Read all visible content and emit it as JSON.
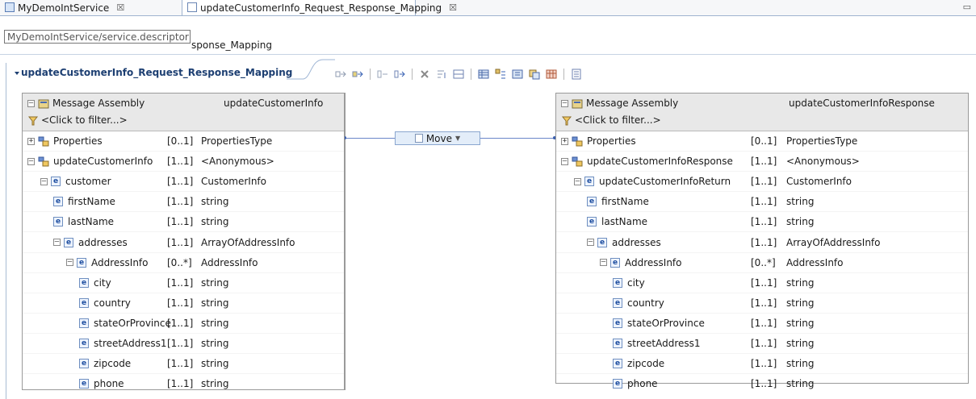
{
  "tabs": [
    {
      "label": "MyDemoIntService",
      "close": "☒"
    },
    {
      "label": "updateCustomerInfo_Request_Response_Mapping",
      "close": "☒"
    }
  ],
  "tooltip": "MyDemoIntService/service.descriptor",
  "subheader_visible_text": "sponse_Mapping",
  "editor_title": "updateCustomerInfo_Request_Response_Mapping",
  "move_label": "Move",
  "left": {
    "title": "Message Assembly",
    "type": "updateCustomerInfo",
    "filter": "<Click to filter...>",
    "rows": [
      {
        "name": "Properties",
        "card": "[0..1]",
        "type": "PropertiesType"
      },
      {
        "name": "updateCustomerInfo",
        "card": "[1..1]",
        "type": "<Anonymous>"
      },
      {
        "name": "customer",
        "card": "[1..1]",
        "type": "CustomerInfo"
      },
      {
        "name": "firstName",
        "card": "[1..1]",
        "type": "string"
      },
      {
        "name": "lastName",
        "card": "[1..1]",
        "type": "string"
      },
      {
        "name": "addresses",
        "card": "[1..1]",
        "type": "ArrayOfAddressInfo"
      },
      {
        "name": "AddressInfo",
        "card": "[0..*]",
        "type": "AddressInfo"
      },
      {
        "name": "city",
        "card": "[1..1]",
        "type": "string"
      },
      {
        "name": "country",
        "card": "[1..1]",
        "type": "string"
      },
      {
        "name": "stateOrProvince",
        "card": "[1..1]",
        "type": "string"
      },
      {
        "name": "streetAddress1",
        "card": "[1..1]",
        "type": "string"
      },
      {
        "name": "zipcode",
        "card": "[1..1]",
        "type": "string"
      },
      {
        "name": "phone",
        "card": "[1..1]",
        "type": "string"
      }
    ]
  },
  "right": {
    "title": "Message Assembly",
    "type": "updateCustomerInfoResponse",
    "filter": "<Click to filter...>",
    "rows": [
      {
        "name": "Properties",
        "card": "[0..1]",
        "type": "PropertiesType"
      },
      {
        "name": "updateCustomerInfoResponse",
        "card": "[1..1]",
        "type": "<Anonymous>"
      },
      {
        "name": "updateCustomerInfoReturn",
        "card": "[1..1]",
        "type": "CustomerInfo"
      },
      {
        "name": "firstName",
        "card": "[1..1]",
        "type": "string"
      },
      {
        "name": "lastName",
        "card": "[1..1]",
        "type": "string"
      },
      {
        "name": "addresses",
        "card": "[1..1]",
        "type": "ArrayOfAddressInfo"
      },
      {
        "name": "AddressInfo",
        "card": "[0..*]",
        "type": "AddressInfo"
      },
      {
        "name": "city",
        "card": "[1..1]",
        "type": "string"
      },
      {
        "name": "country",
        "card": "[1..1]",
        "type": "string"
      },
      {
        "name": "stateOrProvince",
        "card": "[1..1]",
        "type": "string"
      },
      {
        "name": "streetAddress1",
        "card": "[1..1]",
        "type": "string"
      },
      {
        "name": "zipcode",
        "card": "[1..1]",
        "type": "string"
      },
      {
        "name": "phone",
        "card": "[1..1]",
        "type": "string"
      }
    ]
  },
  "colors": {
    "accent": "#1d3f72",
    "link_line": "#6b86c9",
    "header_bg": "#e8e8e8"
  }
}
